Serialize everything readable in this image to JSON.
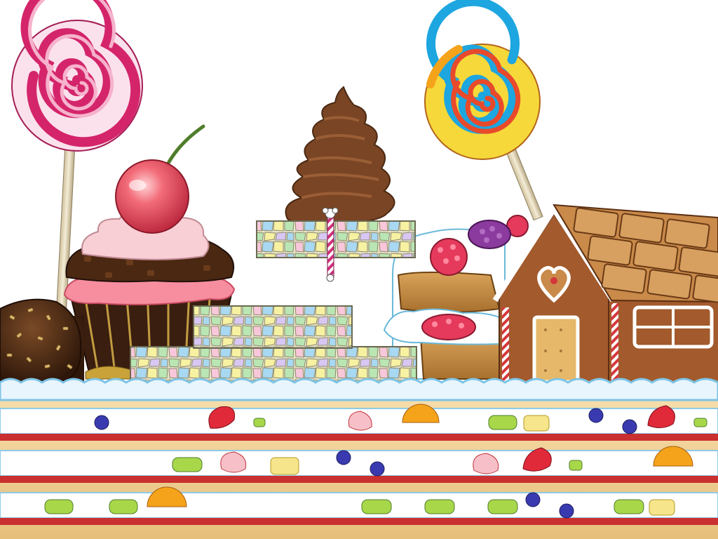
{
  "scene": {
    "background_color": "#ffffff",
    "objects": [
      {
        "name": "lollipop-pink",
        "icon": "lollipop-icon",
        "colors": [
          "#d4256b",
          "#f7b6d0",
          "#ffffff"
        ]
      },
      {
        "name": "lollipop-rainbow",
        "icon": "lollipop-icon",
        "colors": [
          "#f5a31a",
          "#1da6e0",
          "#e84a2b",
          "#f6d83a"
        ]
      },
      {
        "name": "cherry-cupcake",
        "icon": "cupcake-icon",
        "colors": [
          "#e85a6a",
          "#5a3218",
          "#f78ea0"
        ]
      },
      {
        "name": "chocolate-cake-ball",
        "icon": "cake-ball-icon",
        "colors": [
          "#4a2812",
          "#d7b56d"
        ]
      },
      {
        "name": "chocolate-soft-serve",
        "icon": "soft-serve-icon",
        "colors": [
          "#7a4524"
        ]
      },
      {
        "name": "marshmallow-platform-top",
        "icon": "marshmallow-block-icon",
        "colors": [
          "#b7e5b0",
          "#f8f3a6",
          "#d9c8f3",
          "#a9d9f2",
          "#f9c9dc"
        ]
      },
      {
        "name": "marshmallow-platform-middle",
        "icon": "marshmallow-block-icon"
      },
      {
        "name": "marshmallow-platform-bottom",
        "icon": "marshmallow-block-icon"
      },
      {
        "name": "candy-cane-flag",
        "icon": "flag-pole-icon",
        "colors": [
          "#d12f7c",
          "#ffffff"
        ]
      },
      {
        "name": "berry-sponge-cake",
        "icon": "cake-slice-icon",
        "colors": [
          "#c98a3d",
          "#e53a5c",
          "#8b3a9d"
        ]
      },
      {
        "name": "gingerbread-house",
        "icon": "gingerbread-house-icon",
        "colors": [
          "#a35a2c",
          "#c98a4a",
          "#ffffff"
        ]
      },
      {
        "name": "layered-cake-ground",
        "icon": "layer-cake-icon",
        "colors": [
          "#f4d29a",
          "#ffffff",
          "#c9302f",
          "#a9d6ee"
        ]
      }
    ]
  }
}
